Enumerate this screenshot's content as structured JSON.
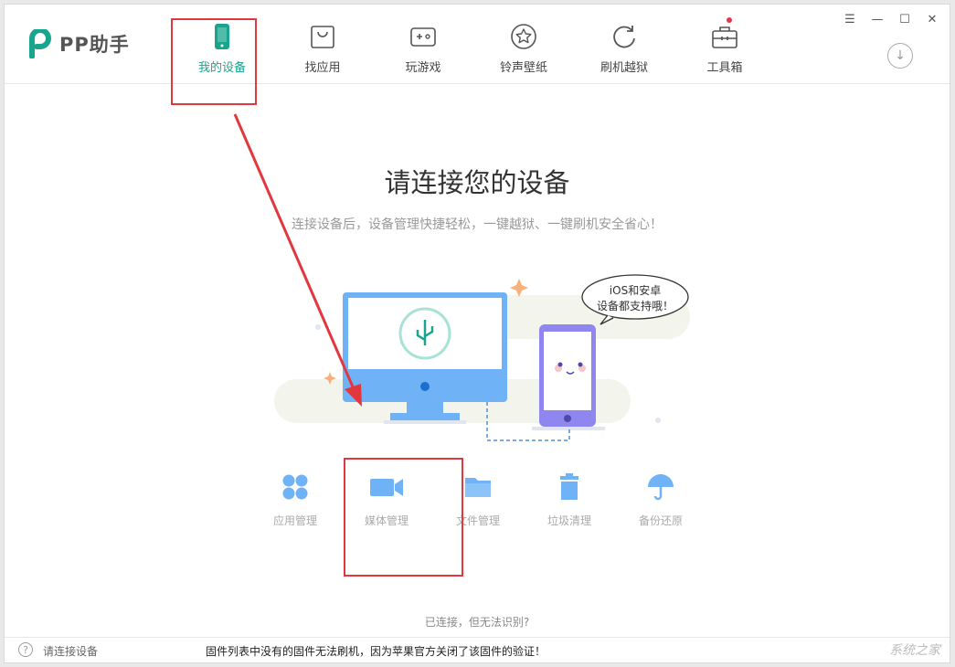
{
  "app": {
    "name": "PP助手"
  },
  "nav": [
    {
      "label": "我的设备",
      "icon": "phone-icon",
      "active": true
    },
    {
      "label": "找应用",
      "icon": "shopping-bag-icon"
    },
    {
      "label": "玩游戏",
      "icon": "gamepad-icon"
    },
    {
      "label": "铃声壁纸",
      "icon": "star-icon"
    },
    {
      "label": "刷机越狱",
      "icon": "refresh-icon"
    },
    {
      "label": "工具箱",
      "icon": "toolbox-icon"
    }
  ],
  "main": {
    "title": "请连接您的设备",
    "subtitle": "连接设备后，设备管理快捷轻松，一键越狱、一键刷机安全省心！",
    "bubble_line1": "iOS和安卓",
    "bubble_line2": "设备都支持哦！",
    "tools": [
      {
        "label": "应用管理",
        "icon": "apps-grid-icon"
      },
      {
        "label": "媒体管理",
        "icon": "video-camera-icon"
      },
      {
        "label": "文件管理",
        "icon": "folder-icon"
      },
      {
        "label": "垃圾清理",
        "icon": "trash-icon"
      },
      {
        "label": "备份还原",
        "icon": "umbrella-icon"
      }
    ],
    "connect_help": "已连接，但无法识别?"
  },
  "status": {
    "device": "请连接设备",
    "message": "固件列表中没有的固件无法刷机，因为苹果官方关闭了该固件的验证！"
  },
  "colors": {
    "accent": "#18a58e",
    "tool_blue": "#6fb3f6",
    "highlight_red": "#e0383e"
  },
  "watermark": "系统之家"
}
